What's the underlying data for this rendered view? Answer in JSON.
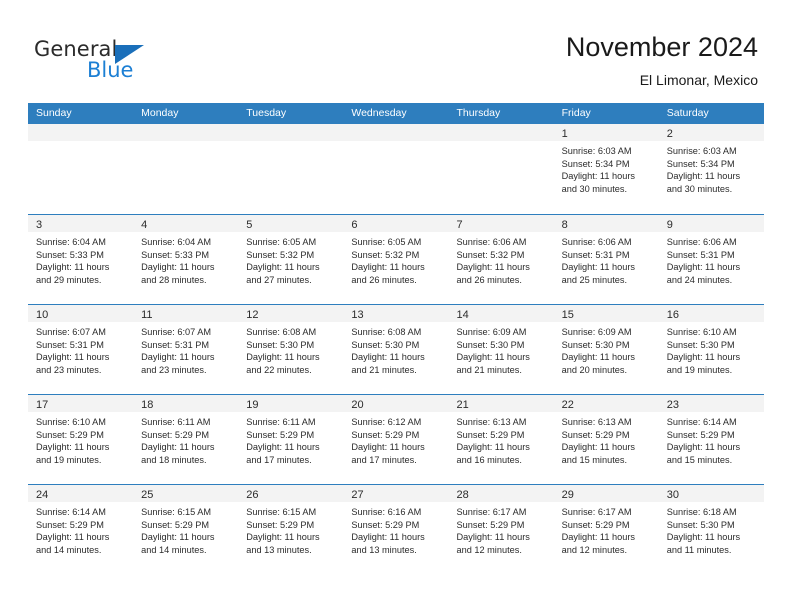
{
  "logo": {
    "word_one": "General",
    "word_two": "Blue",
    "triangle_icon": "triangle-icon",
    "brand_blue": "#1c7fd4",
    "brand_dark_blue": "#1a6fba"
  },
  "header": {
    "title": "November 2024",
    "subtitle": "El Limonar, Mexico"
  },
  "calendar": {
    "header_bg": "#2e7ebe",
    "weekdays": [
      "Sunday",
      "Monday",
      "Tuesday",
      "Wednesday",
      "Thursday",
      "Friday",
      "Saturday"
    ],
    "weeks": [
      [
        {
          "day": "",
          "lines": []
        },
        {
          "day": "",
          "lines": []
        },
        {
          "day": "",
          "lines": []
        },
        {
          "day": "",
          "lines": []
        },
        {
          "day": "",
          "lines": []
        },
        {
          "day": "1",
          "lines": [
            "Sunrise: 6:03 AM",
            "Sunset: 5:34 PM",
            "Daylight: 11 hours",
            "and 30 minutes."
          ]
        },
        {
          "day": "2",
          "lines": [
            "Sunrise: 6:03 AM",
            "Sunset: 5:34 PM",
            "Daylight: 11 hours",
            "and 30 minutes."
          ]
        }
      ],
      [
        {
          "day": "3",
          "lines": [
            "Sunrise: 6:04 AM",
            "Sunset: 5:33 PM",
            "Daylight: 11 hours",
            "and 29 minutes."
          ]
        },
        {
          "day": "4",
          "lines": [
            "Sunrise: 6:04 AM",
            "Sunset: 5:33 PM",
            "Daylight: 11 hours",
            "and 28 minutes."
          ]
        },
        {
          "day": "5",
          "lines": [
            "Sunrise: 6:05 AM",
            "Sunset: 5:32 PM",
            "Daylight: 11 hours",
            "and 27 minutes."
          ]
        },
        {
          "day": "6",
          "lines": [
            "Sunrise: 6:05 AM",
            "Sunset: 5:32 PM",
            "Daylight: 11 hours",
            "and 26 minutes."
          ]
        },
        {
          "day": "7",
          "lines": [
            "Sunrise: 6:06 AM",
            "Sunset: 5:32 PM",
            "Daylight: 11 hours",
            "and 26 minutes."
          ]
        },
        {
          "day": "8",
          "lines": [
            "Sunrise: 6:06 AM",
            "Sunset: 5:31 PM",
            "Daylight: 11 hours",
            "and 25 minutes."
          ]
        },
        {
          "day": "9",
          "lines": [
            "Sunrise: 6:06 AM",
            "Sunset: 5:31 PM",
            "Daylight: 11 hours",
            "and 24 minutes."
          ]
        }
      ],
      [
        {
          "day": "10",
          "lines": [
            "Sunrise: 6:07 AM",
            "Sunset: 5:31 PM",
            "Daylight: 11 hours",
            "and 23 minutes."
          ]
        },
        {
          "day": "11",
          "lines": [
            "Sunrise: 6:07 AM",
            "Sunset: 5:31 PM",
            "Daylight: 11 hours",
            "and 23 minutes."
          ]
        },
        {
          "day": "12",
          "lines": [
            "Sunrise: 6:08 AM",
            "Sunset: 5:30 PM",
            "Daylight: 11 hours",
            "and 22 minutes."
          ]
        },
        {
          "day": "13",
          "lines": [
            "Sunrise: 6:08 AM",
            "Sunset: 5:30 PM",
            "Daylight: 11 hours",
            "and 21 minutes."
          ]
        },
        {
          "day": "14",
          "lines": [
            "Sunrise: 6:09 AM",
            "Sunset: 5:30 PM",
            "Daylight: 11 hours",
            "and 21 minutes."
          ]
        },
        {
          "day": "15",
          "lines": [
            "Sunrise: 6:09 AM",
            "Sunset: 5:30 PM",
            "Daylight: 11 hours",
            "and 20 minutes."
          ]
        },
        {
          "day": "16",
          "lines": [
            "Sunrise: 6:10 AM",
            "Sunset: 5:30 PM",
            "Daylight: 11 hours",
            "and 19 minutes."
          ]
        }
      ],
      [
        {
          "day": "17",
          "lines": [
            "Sunrise: 6:10 AM",
            "Sunset: 5:29 PM",
            "Daylight: 11 hours",
            "and 19 minutes."
          ]
        },
        {
          "day": "18",
          "lines": [
            "Sunrise: 6:11 AM",
            "Sunset: 5:29 PM",
            "Daylight: 11 hours",
            "and 18 minutes."
          ]
        },
        {
          "day": "19",
          "lines": [
            "Sunrise: 6:11 AM",
            "Sunset: 5:29 PM",
            "Daylight: 11 hours",
            "and 17 minutes."
          ]
        },
        {
          "day": "20",
          "lines": [
            "Sunrise: 6:12 AM",
            "Sunset: 5:29 PM",
            "Daylight: 11 hours",
            "and 17 minutes."
          ]
        },
        {
          "day": "21",
          "lines": [
            "Sunrise: 6:13 AM",
            "Sunset: 5:29 PM",
            "Daylight: 11 hours",
            "and 16 minutes."
          ]
        },
        {
          "day": "22",
          "lines": [
            "Sunrise: 6:13 AM",
            "Sunset: 5:29 PM",
            "Daylight: 11 hours",
            "and 15 minutes."
          ]
        },
        {
          "day": "23",
          "lines": [
            "Sunrise: 6:14 AM",
            "Sunset: 5:29 PM",
            "Daylight: 11 hours",
            "and 15 minutes."
          ]
        }
      ],
      [
        {
          "day": "24",
          "lines": [
            "Sunrise: 6:14 AM",
            "Sunset: 5:29 PM",
            "Daylight: 11 hours",
            "and 14 minutes."
          ]
        },
        {
          "day": "25",
          "lines": [
            "Sunrise: 6:15 AM",
            "Sunset: 5:29 PM",
            "Daylight: 11 hours",
            "and 14 minutes."
          ]
        },
        {
          "day": "26",
          "lines": [
            "Sunrise: 6:15 AM",
            "Sunset: 5:29 PM",
            "Daylight: 11 hours",
            "and 13 minutes."
          ]
        },
        {
          "day": "27",
          "lines": [
            "Sunrise: 6:16 AM",
            "Sunset: 5:29 PM",
            "Daylight: 11 hours",
            "and 13 minutes."
          ]
        },
        {
          "day": "28",
          "lines": [
            "Sunrise: 6:17 AM",
            "Sunset: 5:29 PM",
            "Daylight: 11 hours",
            "and 12 minutes."
          ]
        },
        {
          "day": "29",
          "lines": [
            "Sunrise: 6:17 AM",
            "Sunset: 5:29 PM",
            "Daylight: 11 hours",
            "and 12 minutes."
          ]
        },
        {
          "day": "30",
          "lines": [
            "Sunrise: 6:18 AM",
            "Sunset: 5:30 PM",
            "Daylight: 11 hours",
            "and 11 minutes."
          ]
        }
      ]
    ]
  }
}
